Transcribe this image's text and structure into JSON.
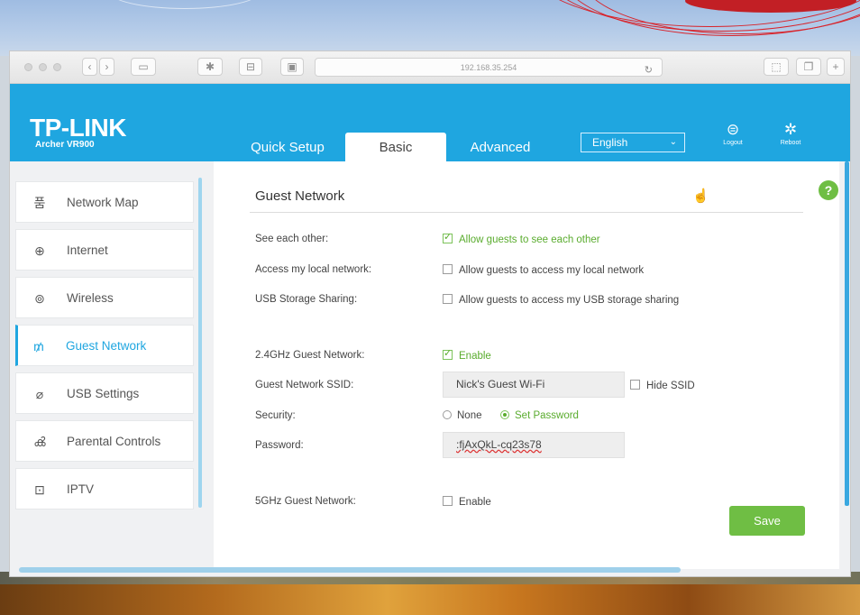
{
  "browser": {
    "url": "192.168.35.254"
  },
  "header": {
    "brand": "TP-LINK",
    "model": "Archer VR900",
    "tabs": [
      {
        "label": "Quick Setup"
      },
      {
        "label": "Basic"
      },
      {
        "label": "Advanced"
      }
    ],
    "language": "English",
    "logout_label": "Logout",
    "reboot_label": "Reboot"
  },
  "sidebar": {
    "items": [
      {
        "label": "Network Map",
        "icon": "network-map-icon"
      },
      {
        "label": "Internet",
        "icon": "globe-icon"
      },
      {
        "label": "Wireless",
        "icon": "wireless-icon"
      },
      {
        "label": "Guest Network",
        "icon": "guest-network-icon"
      },
      {
        "label": "USB Settings",
        "icon": "usb-icon"
      },
      {
        "label": "Parental Controls",
        "icon": "parental-controls-icon"
      },
      {
        "label": "IPTV",
        "icon": "tv-icon"
      }
    ],
    "active": "Guest Network"
  },
  "main": {
    "title": "Guest Network",
    "see_each_other": {
      "label": "See each other:",
      "option": "Allow guests to see each other",
      "checked": true
    },
    "access_local": {
      "label": "Access my local network:",
      "option": "Allow guests to access my local network",
      "checked": false
    },
    "usb_sharing": {
      "label": "USB Storage Sharing:",
      "option": "Allow guests to access my USB storage sharing",
      "checked": false
    },
    "guest_24": {
      "label": "2.4GHz Guest Network:",
      "option": "Enable",
      "checked": true
    },
    "ssid": {
      "label": "Guest Network SSID:",
      "value": "Nick's Guest Wi-Fi",
      "hide_label": "Hide SSID",
      "hide_checked": false
    },
    "security": {
      "label": "Security:",
      "option_none": "None",
      "option_password": "Set Password",
      "selected": "Set Password"
    },
    "password": {
      "label": "Password:",
      "value": ":fjAxQkL-cq23s78"
    },
    "guest_5": {
      "label": "5GHz Guest Network:",
      "option": "Enable",
      "checked": false
    },
    "save_label": "Save"
  },
  "colors": {
    "brand_blue": "#1fa6e0",
    "accent_green": "#6fbe44"
  }
}
